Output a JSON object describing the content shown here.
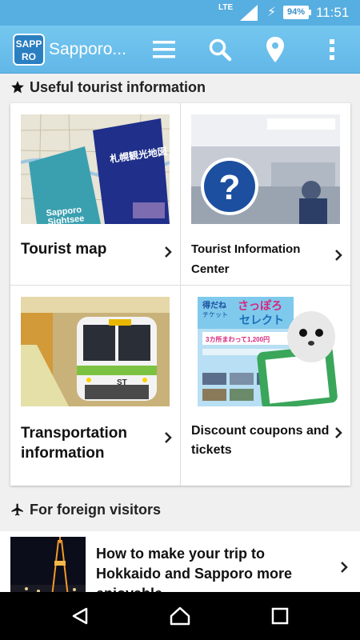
{
  "status_bar": {
    "network": "LTE",
    "battery": "94%",
    "time": "11:51"
  },
  "app_bar": {
    "logo_line1": "SAPP",
    "logo_line2": "RO",
    "title": "Sapporo...",
    "icons": [
      "menu-icon",
      "search-icon",
      "location-pin-icon",
      "overflow-menu-icon"
    ]
  },
  "section_tourist": {
    "icon": "star-icon",
    "heading": "Useful tourist information",
    "cards": [
      {
        "label": "Tourist map"
      },
      {
        "label": "Tourist Information Center"
      },
      {
        "label": "Transportation information"
      },
      {
        "label": "Discount coupons and tickets"
      }
    ],
    "thumb_text": {
      "map_title": "札幌観光地図",
      "map_subtitle1": "Sapporo",
      "map_subtitle2": "Sightsee",
      "coupon_line1": "得だね",
      "coupon_line2": "チケット",
      "coupon_title1": "さっぽろ",
      "coupon_title2": "セレクト",
      "coupon_price": "3カ所まわって1,200円",
      "train_logo": "ST"
    }
  },
  "section_foreign": {
    "icon": "airplane-icon",
    "heading": "For foreign visitors",
    "item_title": "How to make your trip to Hokkaido and Sapporo more enjoyable"
  },
  "colors": {
    "app_bar": "#6cbfeb",
    "status_bar": "#57aee0",
    "background": "#f0f0f0"
  }
}
